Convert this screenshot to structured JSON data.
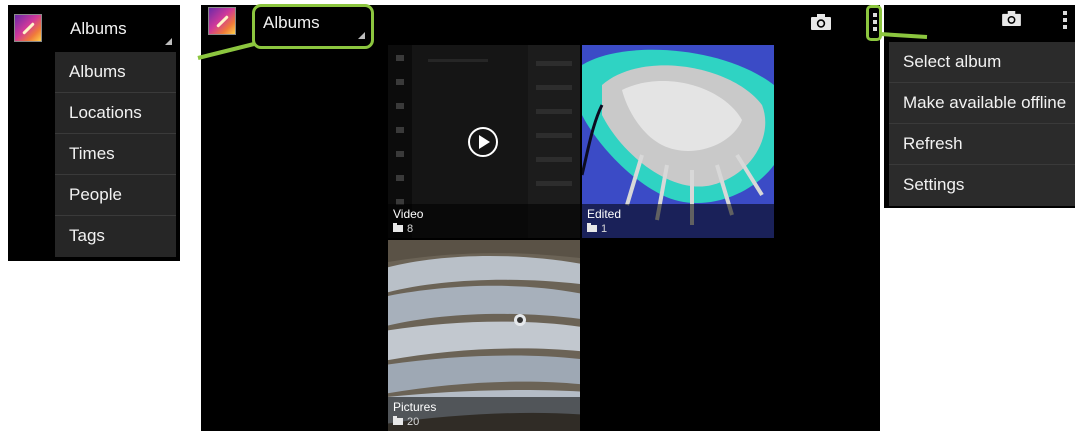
{
  "spinner_panel": {
    "title": "Albums",
    "menu": [
      "Albums",
      "Locations",
      "Times",
      "People",
      "Tags"
    ]
  },
  "main_screen": {
    "title": "Albums",
    "albums": [
      {
        "name": "Video",
        "count": "8"
      },
      {
        "name": "Edited",
        "count": "1"
      },
      {
        "name": "Pictures",
        "count": "20"
      }
    ]
  },
  "overflow_panel": {
    "menu": [
      "Select album",
      "Make available offline",
      "Refresh",
      "Settings"
    ]
  },
  "icons": {
    "app": "gallery-app-icon",
    "camera": "camera-icon",
    "overflow": "overflow-menu-icon",
    "play": "play-icon",
    "folder": "folder-icon"
  },
  "colors": {
    "highlight": "#8cc63f",
    "background": "#000000",
    "menu": "#262626"
  }
}
